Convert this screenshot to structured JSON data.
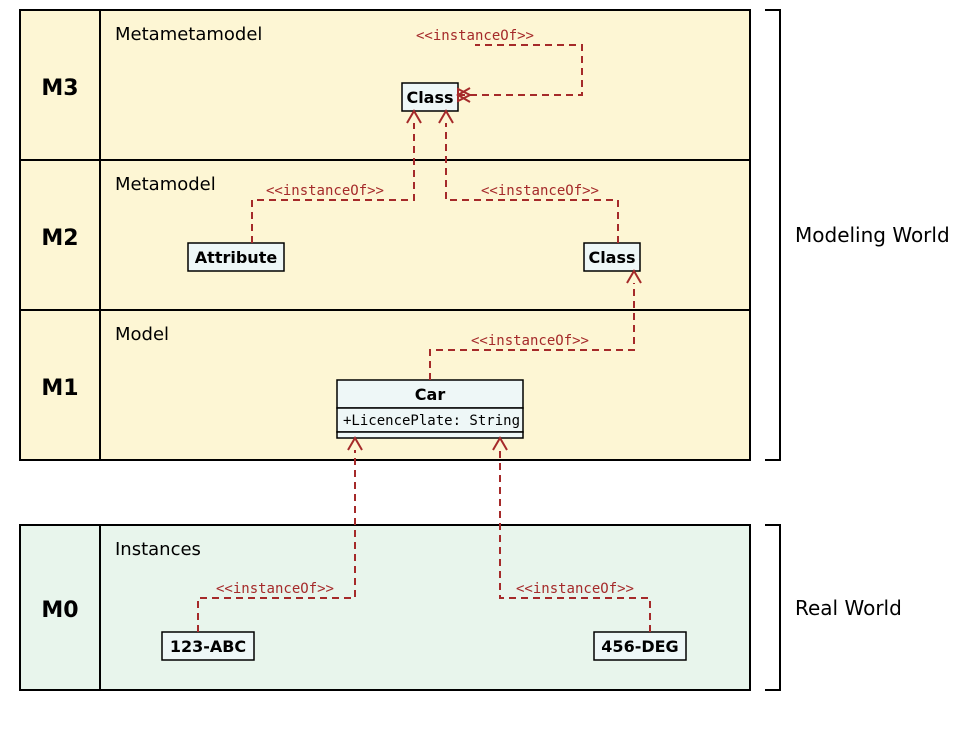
{
  "layers": {
    "m3": {
      "id": "M3",
      "title": "Metametamodel"
    },
    "m2": {
      "id": "M2",
      "title": "Metamodel"
    },
    "m1": {
      "id": "M1",
      "title": "Model"
    },
    "m0": {
      "id": "M0",
      "title": "Instances"
    }
  },
  "boxes": {
    "m3_class": "Class",
    "m2_attribute": "Attribute",
    "m2_class": "Class",
    "m1_car": "Car",
    "m1_car_attr": "+LicencePlate: String",
    "m0_inst1": "123-ABC",
    "m0_inst2": "456-DEG"
  },
  "stereotype": "<<instanceOf>>",
  "worlds": {
    "modeling": "Modeling World",
    "real": "Real World"
  }
}
